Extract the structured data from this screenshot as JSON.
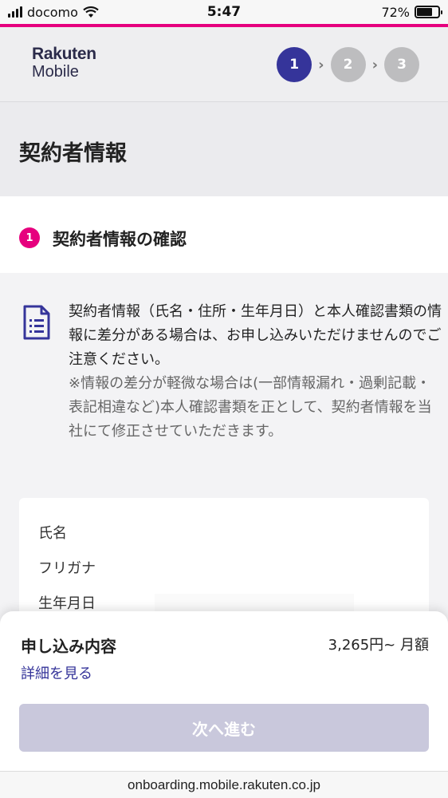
{
  "status": {
    "carrier": "docomo",
    "time": "5:47",
    "battery": "72%",
    "battery_level": 0.72
  },
  "header": {
    "logo_line1": "Rakuten",
    "logo_line2": "Mobile",
    "steps": [
      "1",
      "2",
      "3"
    ],
    "active_step": 1
  },
  "page": {
    "title": "契約者情報"
  },
  "section": {
    "number": "1",
    "title": "契約者情報の確認"
  },
  "notice": {
    "main": "契約者情報（氏名・住所・生年月日）と本人確認書類の情報に差分がある場合は、お申し込みいただけませんのでご注意ください。",
    "sub": "※情報の差分が軽微な場合は(一部情報漏れ・過剰記載・表記相違など)本人確認書類を正として、契約者情報を当社にて修正させていただきます。"
  },
  "info": {
    "name_label": "氏名",
    "kana_label": "フリガナ",
    "dob_label": "生年月日"
  },
  "summary": {
    "title": "申し込み内容",
    "price": "3,265円~ 月額",
    "details_link": "詳細を見る",
    "next_button": "次へ進む"
  },
  "browser": {
    "url": "onboarding.mobile.rakuten.co.jp"
  },
  "colors": {
    "accent": "#e6007e",
    "primary": "#35349a",
    "button_disabled": "#c9c8dc"
  }
}
